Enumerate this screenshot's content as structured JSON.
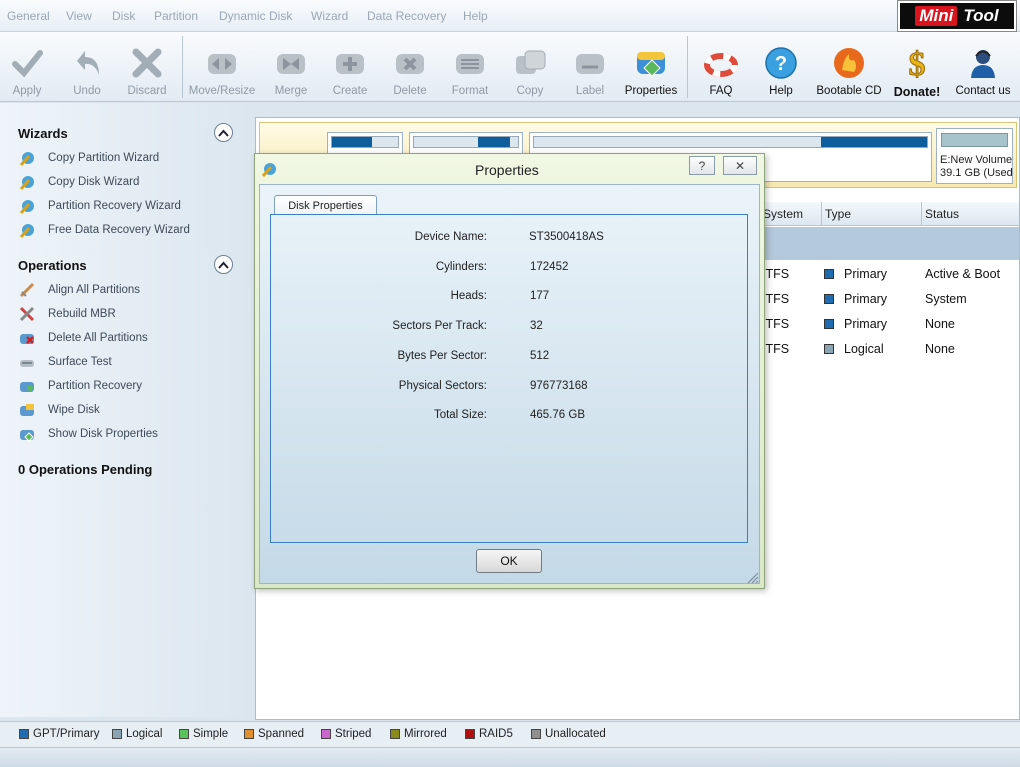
{
  "menu": [
    "General",
    "View",
    "Disk",
    "Partition",
    "Dynamic Disk",
    "Wizard",
    "Data Recovery",
    "Help"
  ],
  "logo": {
    "part1": "Mini",
    "part2": "Tool"
  },
  "toolbar": {
    "apply": "Apply",
    "undo": "Undo",
    "discard": "Discard",
    "move_resize": "Move/Resize",
    "merge": "Merge",
    "create": "Create",
    "delete": "Delete",
    "format": "Format",
    "copy": "Copy",
    "label": "Label",
    "properties": "Properties",
    "faq": "FAQ",
    "help": "Help",
    "bootable_cd": "Bootable CD",
    "donate": "Donate!",
    "contact_us": "Contact us"
  },
  "sidebar": {
    "wizards_title": "Wizards",
    "wizards": [
      "Copy Partition Wizard",
      "Copy Disk Wizard",
      "Partition Recovery Wizard",
      "Free Data Recovery Wizard"
    ],
    "operations_title": "Operations",
    "operations": [
      "Align All Partitions",
      "Rebuild MBR",
      "Delete All Partitions",
      "Surface Test",
      "Partition Recovery",
      "Wipe Disk",
      "Show Disk Properties"
    ],
    "pending": "0 Operations Pending"
  },
  "diskmap": {
    "volume_name": "E:New Volume(",
    "volume_size": "39.1 GB (Used"
  },
  "table": {
    "headers": [
      "System",
      "Type",
      "Status"
    ],
    "rows": [
      {
        "system": "ITFS",
        "type": "Primary",
        "status": "Active & Boot",
        "color": "#1f6cb0"
      },
      {
        "system": "ITFS",
        "type": "Primary",
        "status": "System",
        "color": "#1f6cb0"
      },
      {
        "system": "ITFS",
        "type": "Primary",
        "status": "None",
        "color": "#1f6cb0"
      },
      {
        "system": "ITFS",
        "type": "Logical",
        "status": "None",
        "color": "#8aa4b4"
      }
    ]
  },
  "legend": [
    {
      "label": "GPT/Primary",
      "color": "#1f6cb0"
    },
    {
      "label": "Logical",
      "color": "#8aa4b4"
    },
    {
      "label": "Simple",
      "color": "#5cc25c"
    },
    {
      "label": "Spanned",
      "color": "#e0902c"
    },
    {
      "label": "Striped",
      "color": "#cc66cc"
    },
    {
      "label": "Mirrored",
      "color": "#8a8a1a"
    },
    {
      "label": "RAID5",
      "color": "#b01010"
    },
    {
      "label": "Unallocated",
      "color": "#909090"
    }
  ],
  "dialog": {
    "title": "Properties",
    "help_btn": "?",
    "close_btn": "✕",
    "tab": "Disk Properties",
    "props": [
      {
        "label": "Device Name:",
        "value": "ST3500418AS"
      },
      {
        "label": "Cylinders:",
        "value": "172452"
      },
      {
        "label": "Heads:",
        "value": "177"
      },
      {
        "label": "Sectors Per Track:",
        "value": "32"
      },
      {
        "label": "Bytes Per Sector:",
        "value": "512"
      },
      {
        "label": "Physical Sectors:",
        "value": "976773168"
      },
      {
        "label": "Total Size:",
        "value": "465.76 GB"
      }
    ],
    "ok": "OK"
  }
}
